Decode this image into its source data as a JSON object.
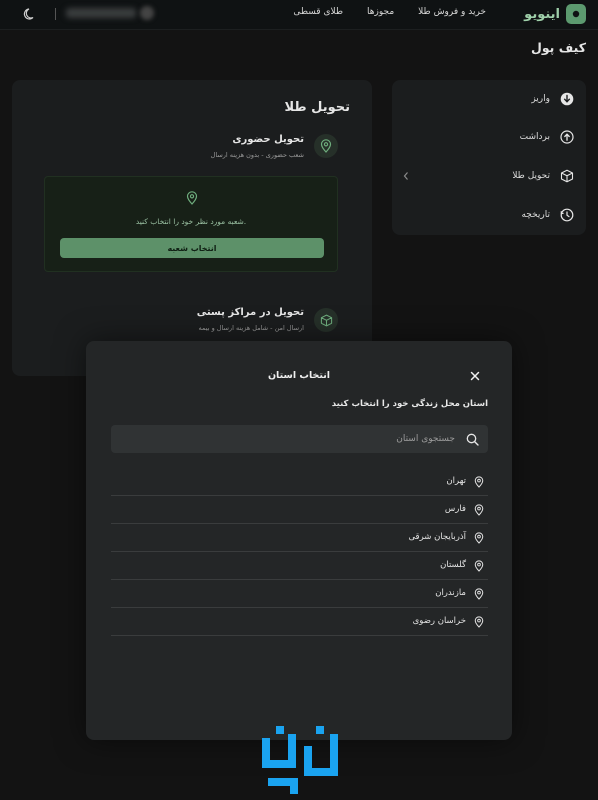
{
  "header": {
    "brand": "اینویو",
    "nav": [
      "خرید و فروش طلا",
      "مجوزها",
      "طلای قسطی"
    ]
  },
  "page": {
    "title": "کیف پول"
  },
  "sidebar": {
    "items": [
      {
        "label": "واریز",
        "icon": "arrow-down-circle-icon"
      },
      {
        "label": "برداشت",
        "icon": "arrow-up-circle-icon"
      },
      {
        "label": "تحویل طلا",
        "icon": "box-icon"
      },
      {
        "label": "تاریخچه",
        "icon": "history-icon"
      }
    ]
  },
  "delivery": {
    "title": "تحویل طلا",
    "in_person": {
      "title": "تحویل حضوری",
      "subtitle": "شعب حضوری - بدون هزینه ارسال"
    },
    "branch": {
      "prompt": "شعبه مورد نظر خود را انتخاب کنید.",
      "button": "انتخاب شعبه"
    },
    "post": {
      "title": "تحویل در مراکز پستی",
      "subtitle": "ارسال امن - شامل هزینه ارسال و بیمه"
    }
  },
  "modal": {
    "title": "انتخاب استان",
    "subtitle": "استان محل زندگی خود را انتخاب کنید",
    "search_placeholder": "جستجوی استان",
    "provinces": [
      "تهران",
      "فارس",
      "آذربایجان شرقی",
      "گلستان",
      "مازندران",
      "خراسان رضوی"
    ]
  },
  "colors": {
    "accent": "#5d9169",
    "background": "#131313",
    "panel": "#1b1d1e",
    "modal": "#242627"
  }
}
